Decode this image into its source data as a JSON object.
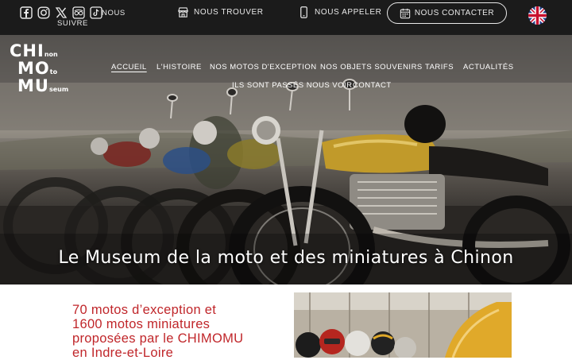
{
  "topbar": {
    "social_icons": [
      "facebook-icon",
      "instagram-icon",
      "x-icon",
      "tripadvisor-icon",
      "tiktok-icon"
    ],
    "follow_line1": "NOUS",
    "follow_line2": "SUIVRE",
    "find_label": "NOUS TROUVER",
    "call_label": "NOUS APPELER",
    "contact_label": "NOUS CONTACTER",
    "language_flag": "uk-flag-icon"
  },
  "logo": {
    "row1_big": "CHI",
    "row1_small": "non",
    "row2_big": "MO",
    "row2_small": "to",
    "row3_big": "MU",
    "row3_small": "seum"
  },
  "nav": {
    "items": [
      "ACCUEIL",
      "L'HISTOIRE",
      "NOS MOTOS D'EXCEPTION",
      "NOS OBJETS SOUVENIRS",
      "TARIFS",
      "ACTUALITÉS",
      "ILS SONT PASSÉS NOUS VOIR",
      "CONTACT"
    ],
    "active": "ACCUEIL"
  },
  "hero": {
    "title": "Le Museum de la moto et des miniatures à Chinon"
  },
  "intro": {
    "lines": [
      "70 motos d’exception et",
      "1600 motos miniatures",
      "proposées par le CHIMOMU",
      "en Indre-et-Loire"
    ]
  },
  "colors": {
    "topbar": "#1b1b1b",
    "accent_red": "#c0262a",
    "hero_text": "#ffffff"
  }
}
